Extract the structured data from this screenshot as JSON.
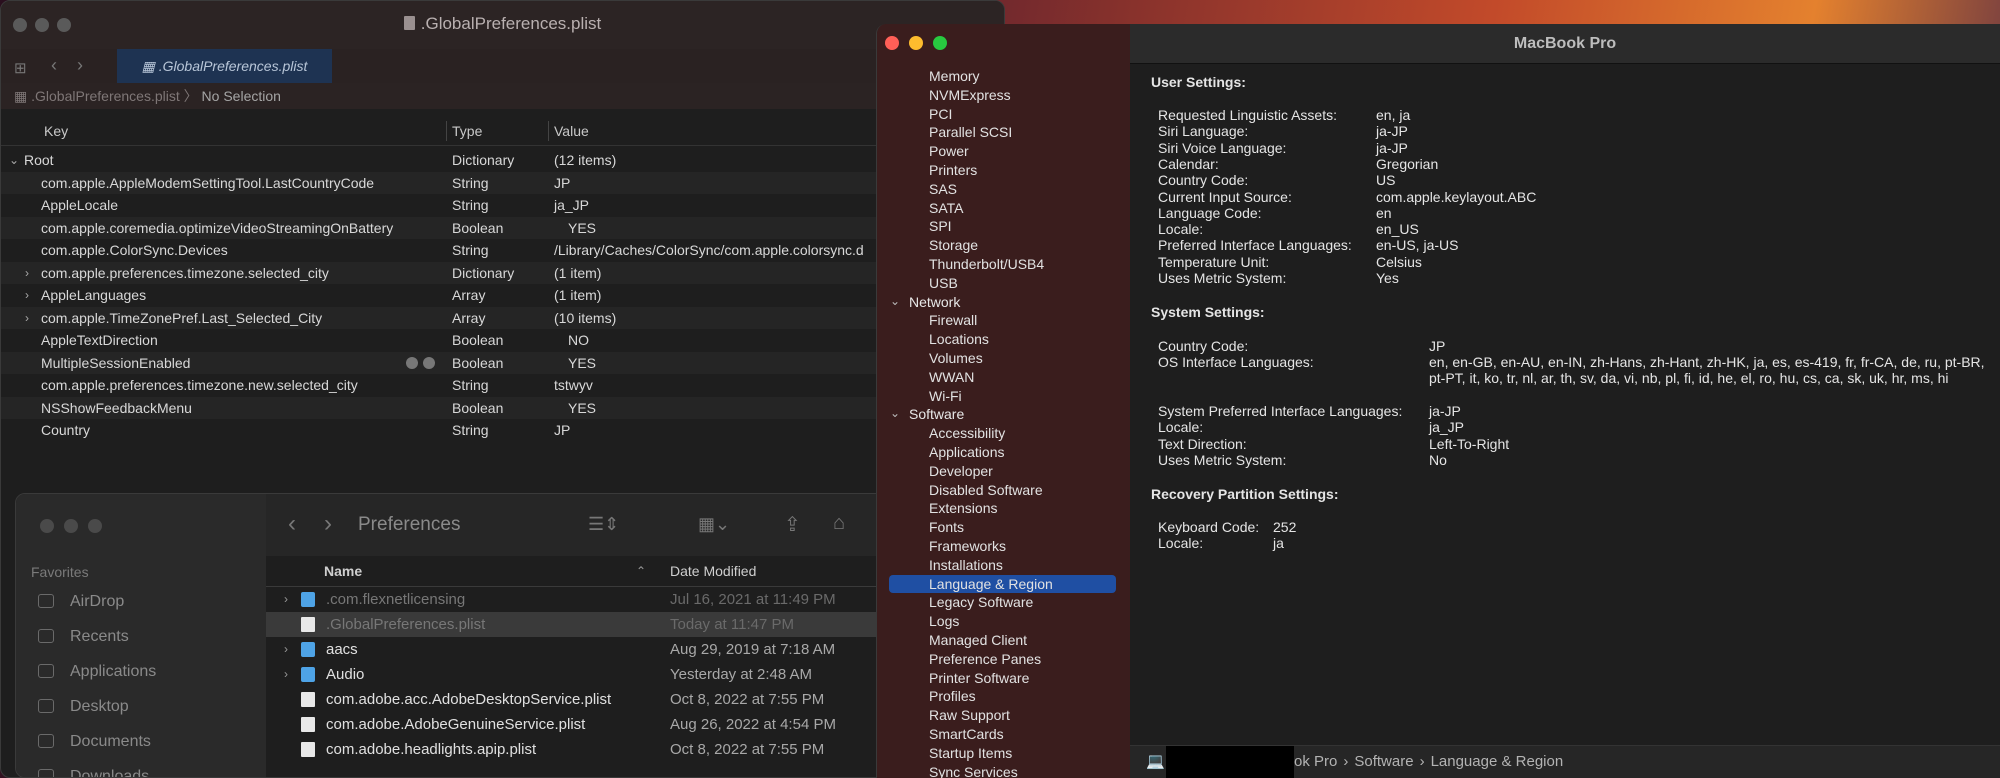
{
  "plist": {
    "title": ".GlobalPreferences.plist",
    "tab": ".GlobalPreferences.plist",
    "path_file": ".GlobalPreferences.plist",
    "path_sep": "〉",
    "path_selection": "No Selection",
    "columns": {
      "key": "Key",
      "type": "Type",
      "value": "Value"
    },
    "rows": [
      {
        "key": "Root",
        "type": "Dictionary",
        "value": "(12 items)",
        "expander": "⌄"
      },
      {
        "key": "com.apple.AppleModemSettingTool.LastCountryCode",
        "type": "String",
        "value": "JP",
        "expander": ""
      },
      {
        "key": "AppleLocale",
        "type": "String",
        "value": "ja_JP",
        "expander": ""
      },
      {
        "key": "com.apple.coremedia.optimizeVideoStreamingOnBattery",
        "type": "Boolean",
        "value": "YES",
        "expander": ""
      },
      {
        "key": "com.apple.ColorSync.Devices",
        "type": "String",
        "value": "/Library/Caches/ColorSync/com.apple.colorsync.d",
        "expander": ""
      },
      {
        "key": "com.apple.preferences.timezone.selected_city",
        "type": "Dictionary",
        "value": "(1 item)",
        "expander": "›"
      },
      {
        "key": "AppleLanguages",
        "type": "Array",
        "value": "(1 item)",
        "expander": "›"
      },
      {
        "key": "com.apple.TimeZonePref.Last_Selected_City",
        "type": "Array",
        "value": "(10 items)",
        "expander": "›"
      },
      {
        "key": "AppleTextDirection",
        "type": "Boolean",
        "value": "NO",
        "expander": ""
      },
      {
        "key": "MultipleSessionEnabled",
        "type": "Boolean",
        "value": "YES",
        "expander": ""
      },
      {
        "key": "com.apple.preferences.timezone.new.selected_city",
        "type": "String",
        "value": "tstwyv",
        "expander": ""
      },
      {
        "key": "NSShowFeedbackMenu",
        "type": "Boolean",
        "value": "YES",
        "expander": ""
      },
      {
        "key": "Country",
        "type": "String",
        "value": "JP",
        "expander": ""
      }
    ]
  },
  "finder": {
    "title": "Preferences",
    "favorites_label": "Favorites",
    "sidebar": [
      "AirDrop",
      "Recents",
      "Applications",
      "Desktop",
      "Documents",
      "Downloads"
    ],
    "columns": {
      "name": "Name",
      "date": "Date Modified"
    },
    "rows": [
      {
        "name": ".com.flexnetlicensing",
        "date": "Jul 16, 2021 at 11:49 PM"
      },
      {
        "name": ".GlobalPreferences.plist",
        "date": "Today at 11:47 PM"
      },
      {
        "name": "aacs",
        "date": "Aug 29, 2019 at 7:18 AM"
      },
      {
        "name": "Audio",
        "date": "Yesterday at 2:48 AM"
      },
      {
        "name": "com.adobe.acc.AdobeDesktopService.plist",
        "date": "Oct 8, 2022 at 7:55 PM"
      },
      {
        "name": "com.adobe.AdobeGenuineService.plist",
        "date": "Aug 26, 2022 at 4:54 PM"
      },
      {
        "name": "com.adobe.headlights.apip.plist",
        "date": "Oct 8, 2022 at 7:55 PM"
      }
    ]
  },
  "sysinfo": {
    "title": "MacBook Pro",
    "tree": [
      {
        "label": "Memory",
        "type": "item"
      },
      {
        "label": "NVMExpress",
        "type": "item"
      },
      {
        "label": "PCI",
        "type": "item"
      },
      {
        "label": "Parallel SCSI",
        "type": "item"
      },
      {
        "label": "Power",
        "type": "item"
      },
      {
        "label": "Printers",
        "type": "item"
      },
      {
        "label": "SAS",
        "type": "item"
      },
      {
        "label": "SATA",
        "type": "item"
      },
      {
        "label": "SPI",
        "type": "item"
      },
      {
        "label": "Storage",
        "type": "item"
      },
      {
        "label": "Thunderbolt/USB4",
        "type": "item"
      },
      {
        "label": "USB",
        "type": "item"
      },
      {
        "label": "Network",
        "type": "cat"
      },
      {
        "label": "Firewall",
        "type": "item"
      },
      {
        "label": "Locations",
        "type": "item"
      },
      {
        "label": "Volumes",
        "type": "item"
      },
      {
        "label": "WWAN",
        "type": "item"
      },
      {
        "label": "Wi-Fi",
        "type": "item"
      },
      {
        "label": "Software",
        "type": "cat"
      },
      {
        "label": "Accessibility",
        "type": "item"
      },
      {
        "label": "Applications",
        "type": "item"
      },
      {
        "label": "Developer",
        "type": "item"
      },
      {
        "label": "Disabled Software",
        "type": "item"
      },
      {
        "label": "Extensions",
        "type": "item"
      },
      {
        "label": "Fonts",
        "type": "item"
      },
      {
        "label": "Frameworks",
        "type": "item"
      },
      {
        "label": "Installations",
        "type": "item"
      },
      {
        "label": "Language & Region",
        "type": "item",
        "selected": true
      },
      {
        "label": "Legacy Software",
        "type": "item"
      },
      {
        "label": "Logs",
        "type": "item"
      },
      {
        "label": "Managed Client",
        "type": "item"
      },
      {
        "label": "Preference Panes",
        "type": "item"
      },
      {
        "label": "Printer Software",
        "type": "item"
      },
      {
        "label": "Profiles",
        "type": "item"
      },
      {
        "label": "Raw Support",
        "type": "item"
      },
      {
        "label": "SmartCards",
        "type": "item"
      },
      {
        "label": "Startup Items",
        "type": "item"
      },
      {
        "label": "Sync Services",
        "type": "item"
      }
    ],
    "user_settings": {
      "heading": "User Settings:",
      "rows": [
        [
          "Requested Linguistic Assets:",
          "en, ja"
        ],
        [
          "Siri Language:",
          "ja-JP"
        ],
        [
          "Siri Voice Language:",
          "ja-JP"
        ],
        [
          "Calendar:",
          "Gregorian"
        ],
        [
          "Country Code:",
          "US"
        ],
        [
          "Current Input Source:",
          "com.apple.keylayout.ABC"
        ],
        [
          "Language Code:",
          "en"
        ],
        [
          "Locale:",
          "en_US"
        ],
        [
          "Preferred Interface Languages:",
          "en-US, ja-US"
        ],
        [
          "Temperature Unit:",
          "Celsius"
        ],
        [
          "Uses Metric System:",
          "Yes"
        ]
      ]
    },
    "system_settings": {
      "heading": "System Settings:",
      "country_code": [
        "Country Code:",
        "JP"
      ],
      "os_languages": [
        "OS Interface Languages:",
        "en, en-GB, en-AU, en-IN, zh-Hans, zh-Hant, zh-HK, ja, es, es-419, fr, fr-CA, de, ru, pt-BR, pt-PT, it, ko, tr, nl, ar, th, sv, da, vi, nb, pl, fi, id, he, el, ro, hu, cs, ca, sk, uk, hr, ms, hi"
      ],
      "rows": [
        [
          "System Preferred Interface Languages:",
          "ja-JP"
        ],
        [
          "Locale:",
          "ja_JP"
        ],
        [
          "Text Direction:",
          "Left-To-Right"
        ],
        [
          "Uses Metric System:",
          "No"
        ]
      ]
    },
    "recovery_settings": {
      "heading": "Recovery Partition Settings:",
      "rows": [
        [
          "Keyboard Code:",
          "252"
        ],
        [
          "Locale:",
          "ja"
        ]
      ]
    },
    "breadcrumb": [
      "ok Pro",
      "Software",
      "Language & Region"
    ],
    "breadcrumb_sep": "›"
  }
}
